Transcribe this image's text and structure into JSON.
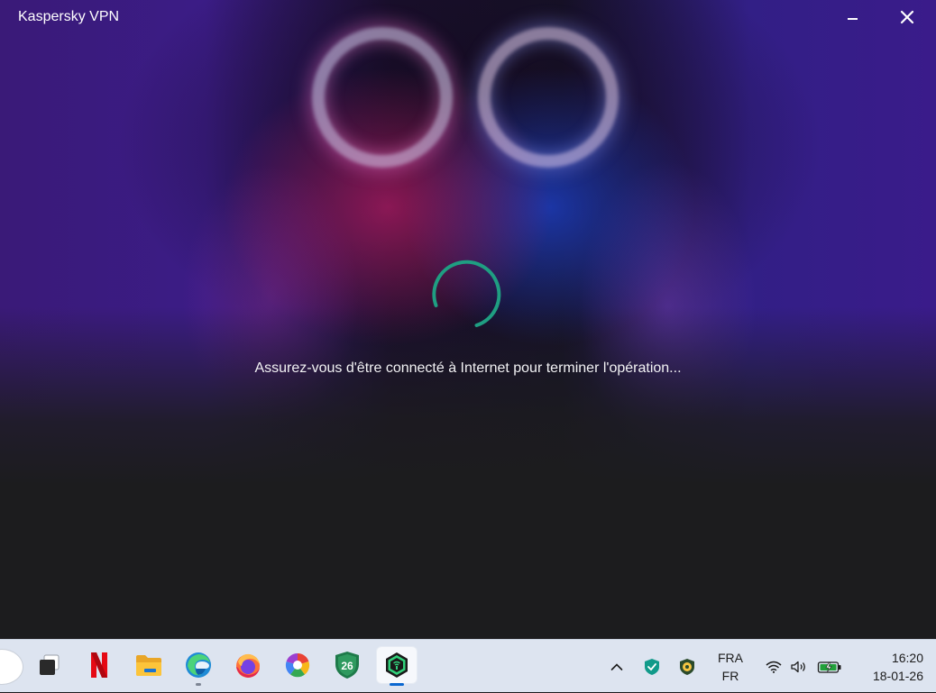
{
  "window": {
    "title": "Kaspersky VPN",
    "minimize_icon": "minimize-icon",
    "close_icon": "close-icon"
  },
  "main": {
    "spinner_color": "#1f9e82",
    "status_message": "Assurez-vous d'être connecté à Internet pour terminer l'opération..."
  },
  "taskbar": {
    "apps": [
      {
        "name": "task-view",
        "icon": "task-view-icon"
      },
      {
        "name": "netflix",
        "icon": "netflix-icon",
        "label": "N"
      },
      {
        "name": "file-explorer",
        "icon": "folder-icon"
      },
      {
        "name": "edge",
        "icon": "edge-icon",
        "running": true
      },
      {
        "name": "firefox",
        "icon": "firefox-icon"
      },
      {
        "name": "picasa",
        "icon": "picasa-icon"
      },
      {
        "name": "kaspersky-26",
        "icon": "kaspersky-shield-icon",
        "label": "26"
      },
      {
        "name": "kaspersky-vpn",
        "icon": "kaspersky-vpn-icon",
        "active": true
      }
    ],
    "tray": {
      "chevron_icon": "chevron-up-icon",
      "security_icons": [
        "shield-check-icon",
        "avast-shield-icon"
      ],
      "language_line1": "FRA",
      "language_line2": "FR",
      "network_icon": "wifi-icon",
      "volume_icon": "volume-icon",
      "battery_icon": "battery-charging-icon",
      "time": "16:20",
      "date": "18-01-26"
    }
  }
}
